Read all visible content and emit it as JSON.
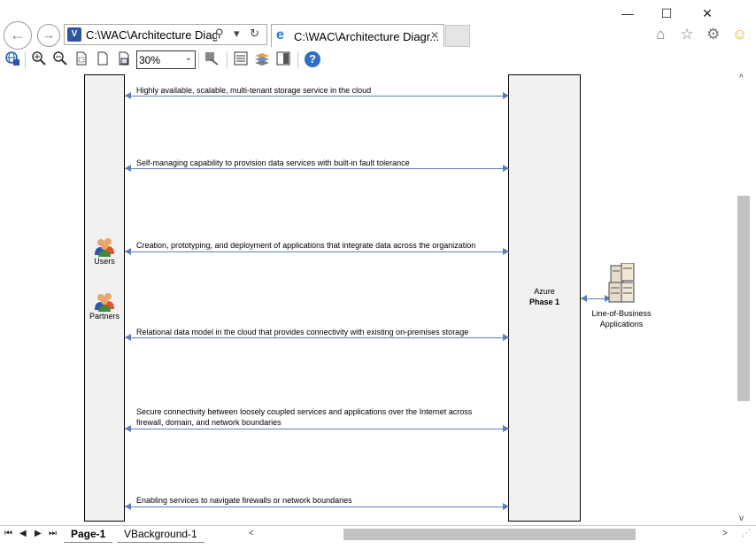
{
  "window": {
    "minimize": "—",
    "maximize": "☐",
    "close": "✕"
  },
  "nav": {
    "back": "←",
    "forward": "→"
  },
  "address": {
    "icon_letter": "V",
    "text": "C:\\WAC\\Architecture Diagra",
    "icons": "⚲ ▾ ↻"
  },
  "tab": {
    "title": "C:\\WAC\\Architecture Diagr...",
    "close": "✕",
    "icon_letter": "e"
  },
  "toolbar": {
    "zoom_value": "30%",
    "zoom_arrow": "⌄",
    "help": "?"
  },
  "browser_icons": {
    "home": "⌂",
    "favorites": "☆",
    "settings": "⚙",
    "feedback": "☺"
  },
  "diagram": {
    "actors": [
      {
        "label": "Users"
      },
      {
        "label": "Partners"
      }
    ],
    "azure": {
      "line1": "Azure",
      "line2": "Phase 1"
    },
    "lob": {
      "line1": "Line-of-Business",
      "line2": "Applications"
    },
    "messages": [
      {
        "text": "Highly available, scalable, multi-tenant storage service in the cloud"
      },
      {
        "text": "Self-managing capability to provision data services with built-in fault tolerance"
      },
      {
        "text": "Creation, prototyping, and deployment of applications that integrate data across the organization"
      },
      {
        "text": "Relational data model in the cloud that provides connectivity with existing on-premises storage"
      },
      {
        "text": "Secure connectivity between loosely coupled services and applications over the Internet across firewall, domain, and network boundaries"
      },
      {
        "text": "Enabling services to navigate firewalls or network boundaries"
      }
    ]
  },
  "status": {
    "first": "⏮",
    "prev": "◀",
    "next": "▶",
    "last": "⏭",
    "tabs": [
      {
        "label": "Page-1"
      },
      {
        "label": "VBackground-1"
      }
    ],
    "scroll_left": "<",
    "scroll_right": ">",
    "resize_grip": "⋰"
  },
  "vscroll": {
    "up": "^",
    "down": "v"
  }
}
